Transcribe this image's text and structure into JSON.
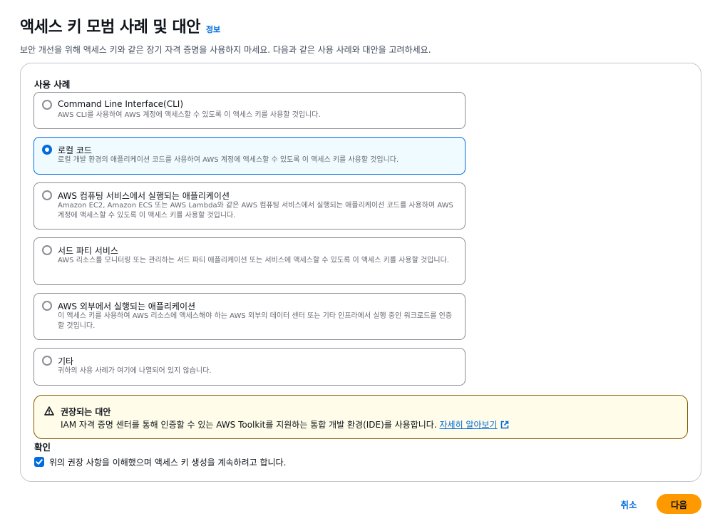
{
  "header": {
    "title": "액세스 키 모범 사례 및 대안",
    "info_link": "정보",
    "description": "보안 개선을 위해 액세스 키와 같은 장기 자격 증명을 사용하지 마세요. 다음과 같은 사용 사례와 대안을 고려하세요."
  },
  "use_cases": {
    "label": "사용 사례",
    "options": [
      {
        "title": "Command Line Interface(CLI)",
        "description": "AWS CLI를 사용하여 AWS 계정에 액세스할 수 있도록 이 액세스 키를 사용할 것입니다.",
        "selected": false
      },
      {
        "title": "로컬 코드",
        "description": "로컬 개발 환경의 애플리케이션 코드를 사용하여 AWS 계정에 액세스할 수 있도록 이 액세스 키를 사용할 것입니다.",
        "selected": true
      },
      {
        "title": "AWS 컴퓨팅 서비스에서 실행되는 애플리케이션",
        "description": "Amazon EC2, Amazon ECS 또는 AWS Lambda와 같은 AWS 컴퓨팅 서비스에서 실행되는 애플리케이션 코드를 사용하여 AWS 계정에 액세스할 수 있도록 이 액세스 키를 사용할 것입니다.",
        "selected": false
      },
      {
        "title": "서드 파티 서비스",
        "description": "AWS 리소스를 모니터링 또는 관리하는 서드 파티 애플리케이션 또는 서비스에 액세스할 수 있도록 이 액세스 키를 사용할 것입니다.",
        "selected": false
      },
      {
        "title": "AWS 외부에서 실행되는 애플리케이션",
        "description": "이 액세스 키를 사용하여 AWS 리소스에 액세스해야 하는 AWS 외부의 데이터 센터 또는 기타 인프라에서 실행 중인 워크로드를 인증할 것입니다.",
        "selected": false
      },
      {
        "title": "기타",
        "description": "귀하의 사용 사례가 여기에 나열되어 있지 않습니다.",
        "selected": false
      }
    ]
  },
  "alert": {
    "icon": "warning-icon",
    "title": "권장되는 대안",
    "body": "IAM 자격 증명 센터를 통해 인증할 수 있는 AWS Toolkit를 지원하는 통합 개발 환경(IDE)를 사용합니다.",
    "link": "자세히 알아보기"
  },
  "confirmation": {
    "label": "확인",
    "checkbox_label": "위의 권장 사항을 이해했으며 액세스 키 생성을 계속하려고 합니다.",
    "checked": true
  },
  "footer": {
    "cancel_label": "취소",
    "next_label": "다음"
  },
  "colors": {
    "accent": "#006ce0",
    "primary_button": "#ff9900",
    "warning_border": "#855900",
    "warning_background": "#fffce9"
  }
}
